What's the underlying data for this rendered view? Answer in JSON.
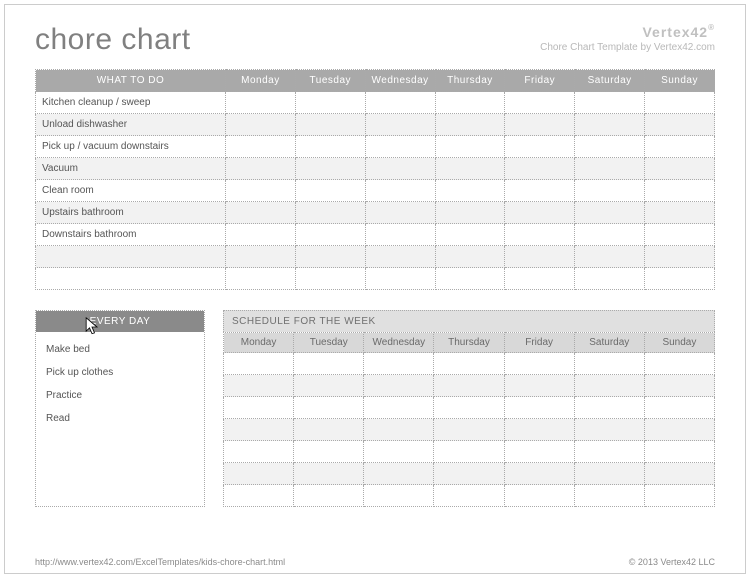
{
  "header": {
    "title": "chore chart",
    "brand_name": "Vertex42",
    "brand_tagline": "Chore Chart Template by Vertex42.com"
  },
  "main_table": {
    "header_task": "WHAT TO DO",
    "days": [
      "Monday",
      "Tuesday",
      "Wednesday",
      "Thursday",
      "Friday",
      "Saturday",
      "Sunday"
    ],
    "rows": [
      "Kitchen cleanup / sweep",
      "Unload dishwasher",
      "Pick up / vacuum downstairs",
      "Vacuum",
      "Clean room",
      "Upstairs bathroom",
      "Downstairs bathroom",
      "",
      ""
    ]
  },
  "every_day": {
    "header": "EVERY DAY",
    "items": [
      "Make bed",
      "Pick up clothes",
      "Practice",
      "Read"
    ]
  },
  "schedule": {
    "title": "SCHEDULE FOR THE WEEK",
    "days": [
      "Monday",
      "Tuesday",
      "Wednesday",
      "Thursday",
      "Friday",
      "Saturday",
      "Sunday"
    ],
    "row_count": 7
  },
  "footer": {
    "url": "http://www.vertex42.com/ExcelTemplates/kids-chore-chart.html",
    "copyright": "© 2013 Vertex42 LLC"
  }
}
